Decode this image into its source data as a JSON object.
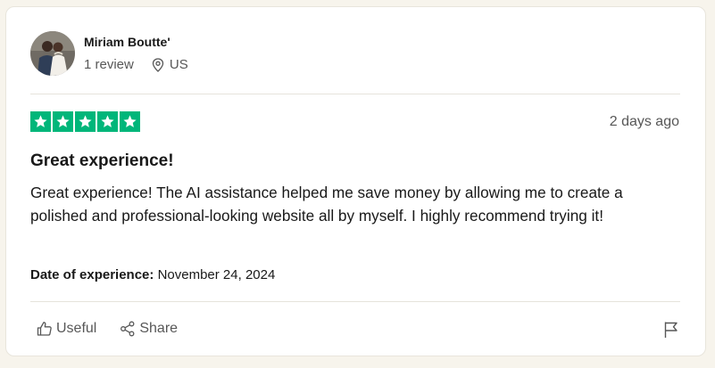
{
  "reviewer": {
    "name": "Miriam Boutte'",
    "review_count": "1 review",
    "country": "US"
  },
  "review": {
    "rating": 5,
    "max_rating": 5,
    "star_color": "#00b67a",
    "posted_ago": "2 days ago",
    "title": "Great experience!",
    "body": "Great experience! The AI assistance helped me save money by allowing me to create a polished and professional-looking website all by myself. I highly recommend trying it!",
    "experience_label": "Date of experience:",
    "experience_date": "November 24, 2024"
  },
  "actions": {
    "useful_label": "Useful",
    "share_label": "Share"
  },
  "icons": {
    "location": "location-pin-icon",
    "useful": "thumbs-up-icon",
    "share": "share-icon",
    "report": "flag-icon"
  }
}
